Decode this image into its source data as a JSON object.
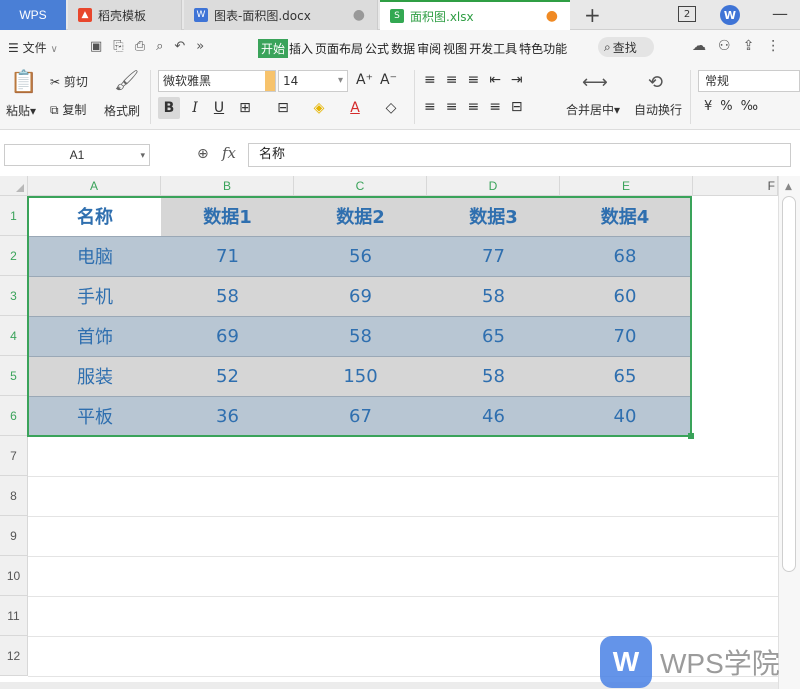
{
  "tabs": {
    "wps": "WPS",
    "tab1": "稻壳模板",
    "tab2": "图表-面积图.docx",
    "tab3": "面积图.xlsx",
    "window_count": "2"
  },
  "menu": {
    "file": "文件",
    "tabs": [
      "开始",
      "插入",
      "页面布局",
      "公式",
      "数据",
      "审阅",
      "视图",
      "开发工具",
      "特色功能"
    ],
    "search": "查找"
  },
  "ribbon": {
    "paste": "粘贴",
    "cut": "剪切",
    "copy": "复制",
    "format_painter": "格式刷",
    "font_name": "微软雅黑",
    "font_size": "14",
    "merge_center": "合并居中",
    "wrap_text": "自动换行",
    "number_format": "常规"
  },
  "formula_bar": {
    "cell_ref": "A1",
    "fx": "fx",
    "content": "名称"
  },
  "sheet": {
    "columns": [
      "A",
      "B",
      "C",
      "D",
      "E",
      "F"
    ],
    "rows": [
      "1",
      "2",
      "3",
      "4",
      "5",
      "6",
      "7",
      "8",
      "9",
      "10",
      "11",
      "12"
    ],
    "header": [
      "名称",
      "数据1",
      "数据2",
      "数据3",
      "数据4"
    ],
    "data": [
      [
        "电脑",
        "71",
        "56",
        "77",
        "68"
      ],
      [
        "手机",
        "58",
        "69",
        "58",
        "60"
      ],
      [
        "首饰",
        "69",
        "58",
        "65",
        "70"
      ],
      [
        "服装",
        "52",
        "150",
        "58",
        "65"
      ],
      [
        "平板",
        "36",
        "67",
        "46",
        "40"
      ]
    ]
  },
  "watermark": {
    "logo": "W",
    "text": "WPS学院"
  },
  "colors": {
    "accent_green": "#3aa35a",
    "cell_text_blue": "#2f6faf",
    "row_dark": "#b8c6d3",
    "row_light": "#d6d6d6"
  }
}
